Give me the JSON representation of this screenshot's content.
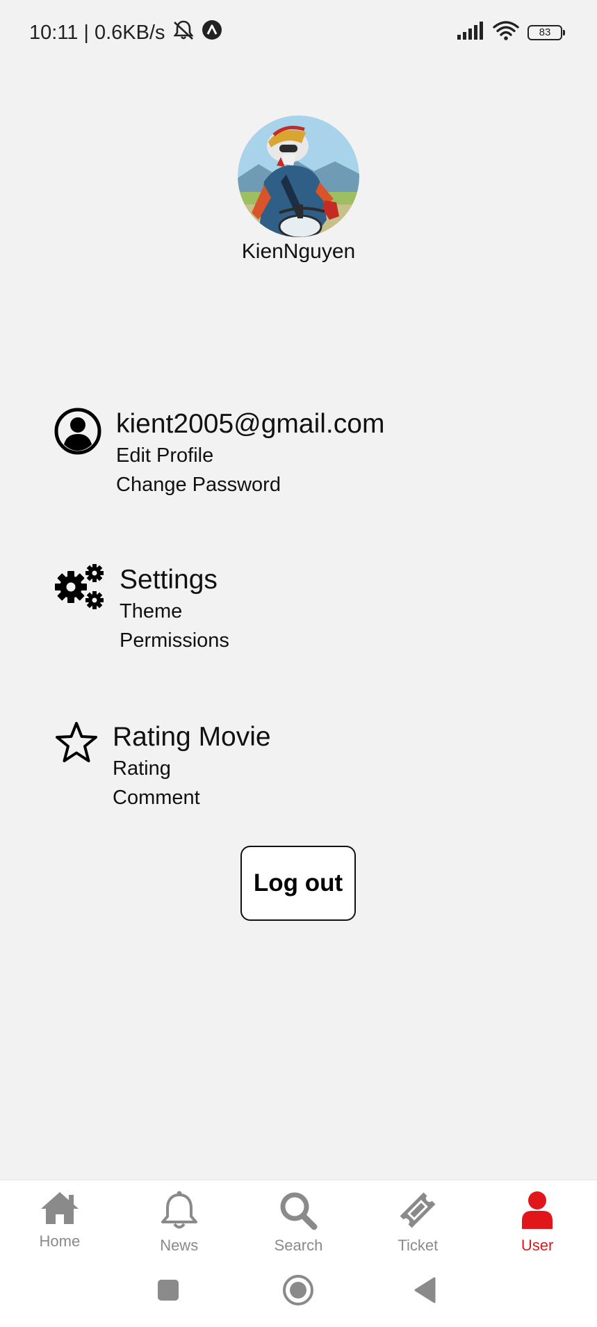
{
  "status_bar": {
    "time": "10:11",
    "separator": "|",
    "speed": "0.6KB/s",
    "battery": "83",
    "icons": [
      "mute-bell-icon",
      "app-notification-icon",
      "signal-icon",
      "wifi-icon",
      "battery-icon"
    ]
  },
  "profile": {
    "avatar": "avatar-motocross-rider",
    "username": "KienNguyen"
  },
  "sections": {
    "account": {
      "icon": "account-circle-icon",
      "title": "kient2005@gmail.com",
      "items": [
        "Edit Profile",
        "Change Password"
      ]
    },
    "settings": {
      "icon": "gears-icon",
      "title": "Settings",
      "items": [
        "Theme",
        "Permissions"
      ]
    },
    "rating": {
      "icon": "star-outline-icon",
      "title": "Rating Movie",
      "items": [
        "Rating",
        "Comment"
      ]
    }
  },
  "logout_label": "Log out",
  "bottom_nav": {
    "items": [
      {
        "label": "Home",
        "icon": "home-icon",
        "active": false
      },
      {
        "label": "News",
        "icon": "bell-icon",
        "active": false
      },
      {
        "label": "Search",
        "icon": "search-icon",
        "active": false
      },
      {
        "label": "Ticket",
        "icon": "ticket-icon",
        "active": false
      },
      {
        "label": "User",
        "icon": "user-icon",
        "active": true
      }
    ]
  },
  "colors": {
    "background": "#f2f2f2",
    "accent": "#e0161b",
    "nav_inactive": "#8a8a8a"
  },
  "system_nav": {
    "icons": [
      "recents-square-icon",
      "home-circle-icon",
      "back-triangle-icon"
    ]
  }
}
